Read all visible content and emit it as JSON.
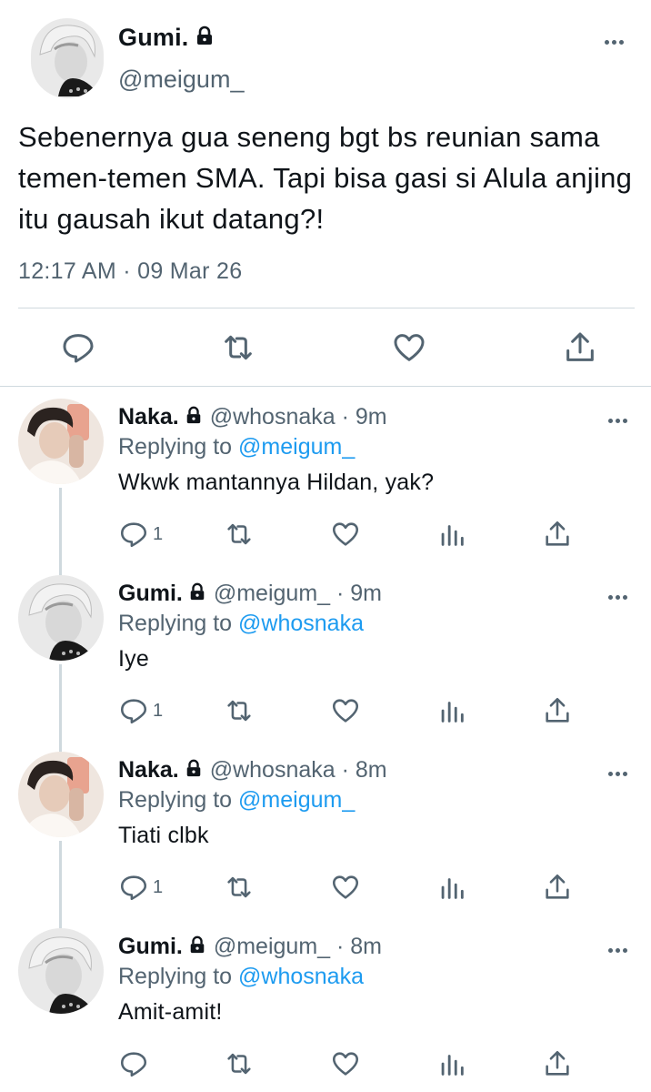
{
  "main_tweet": {
    "name": "Gumi.",
    "handle": "@meigum_",
    "text": "Sebenernya gua seneng bgt bs reunian sama temen-temen SMA. Tapi bisa gasi si Alula anjing itu gausah ikut datang?!",
    "timestamp": "12:17 AM · 09 Mar 26",
    "actions": [
      "reply-icon",
      "retweet-icon",
      "like-icon",
      "share-icon"
    ]
  },
  "replies": [
    {
      "name": "Naka.",
      "handle": "@whosnaka · 9m",
      "replying_prefix": "Replying to ",
      "replying_to": "@meigum_",
      "text": "Wkwk mantannya Hildan, yak?",
      "reply_count": "1"
    },
    {
      "name": "Gumi.",
      "handle": "@meigum_ · 9m",
      "replying_prefix": "Replying to ",
      "replying_to": "@whosnaka",
      "text": "Iye",
      "reply_count": "1"
    },
    {
      "name": "Naka.",
      "handle": "@whosnaka · 8m",
      "replying_prefix": "Replying to ",
      "replying_to": "@meigum_",
      "text": "Tiati clbk",
      "reply_count": "1"
    },
    {
      "name": "Gumi.",
      "handle": "@meigum_ · 8m",
      "replying_prefix": "Replying to ",
      "replying_to": "@whosnaka",
      "text": "Amit-amit!",
      "reply_count": ""
    }
  ],
  "colors": {
    "text": "#0f1419",
    "secondary": "#536471",
    "link": "#1d9bf0",
    "divider": "#cfd9de"
  }
}
